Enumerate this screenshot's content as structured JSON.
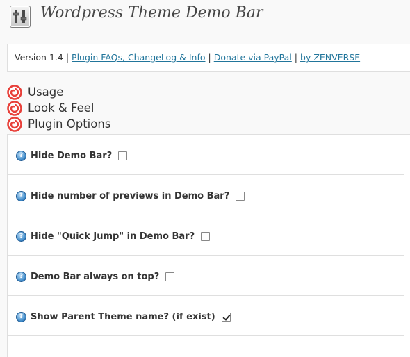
{
  "header": {
    "title": "Wordpress Theme Demo Bar",
    "icon": "plugin-settings-icon"
  },
  "infobar": {
    "version": "Version 1.4",
    "links": [
      "Plugin FAQs, ChangeLog & Info",
      "Donate via PayPal",
      "by ZENVERSE"
    ],
    "link_color": "#21759b"
  },
  "sections": [
    {
      "label": "Usage",
      "icon": "spiral-icon"
    },
    {
      "label": "Look & Feel",
      "icon": "spiral-icon"
    },
    {
      "label": "Plugin Options",
      "icon": "spiral-icon"
    }
  ],
  "options": [
    {
      "label": "Hide Demo Bar?",
      "checked": false
    },
    {
      "label": "Hide number of previews in Demo Bar?",
      "checked": false
    },
    {
      "label": "Hide \"Quick Jump\" in Demo Bar?",
      "checked": false
    },
    {
      "label": "Demo Bar always on top?",
      "checked": false
    },
    {
      "label": "Show Parent Theme name? (if exist)",
      "checked": true
    }
  ],
  "help_glyph": "?",
  "accent_color": "#e8403a"
}
